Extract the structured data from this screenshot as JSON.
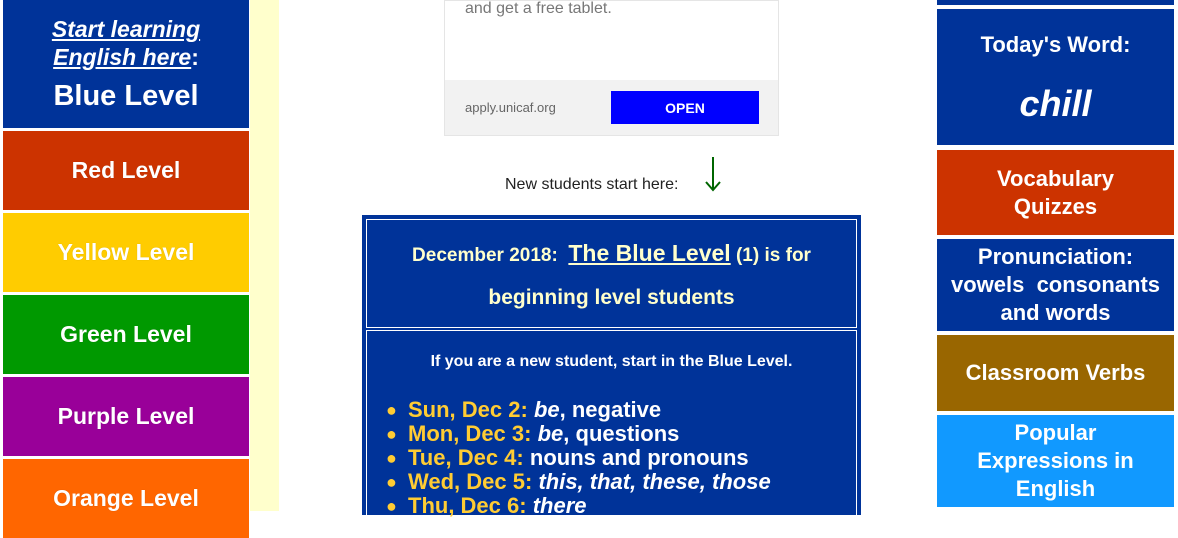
{
  "left_nav": {
    "learn_label_1": "Start learning",
    "learn_label_2": "English here",
    "learn_colon": ":",
    "current_level": "Blue Level",
    "levels": [
      {
        "label": "Red Level",
        "color": "#cc3300"
      },
      {
        "label": "Yellow Level",
        "color": "#ffcc00"
      },
      {
        "label": "Green Level",
        "color": "#009900"
      },
      {
        "label": "Purple Level",
        "color": "#990099"
      },
      {
        "label": "Orange Level",
        "color": "#ff6600"
      }
    ]
  },
  "ad": {
    "text": "and get a free tablet.",
    "url": "apply.unicaf.org",
    "button": "OPEN"
  },
  "new_students": "New students start here:",
  "main": {
    "date": "December 2018:",
    "level_link": "The Blue Level",
    "level_num": "(1)",
    "is_for": "is for",
    "audience": "beginning level students",
    "intro": "If you are a new student, start in the Blue Level.",
    "lessons": [
      {
        "day": "Sun, Dec 2:",
        "topic_italic": "be",
        "topic": ", negative"
      },
      {
        "day": "Mon, Dec 3:",
        "topic_italic": "be",
        "topic": ", questions"
      },
      {
        "day": "Tue, Dec 4:",
        "topic_italic": "",
        "topic": "nouns and pronouns"
      },
      {
        "day": "Wed, Dec 5:",
        "topic_italic": "this, that, these, those",
        "topic": ""
      },
      {
        "day": "Thu, Dec 6:",
        "topic_italic": "there",
        "topic": ""
      }
    ]
  },
  "right_nav": {
    "word_label": "Today's Word:",
    "word": "chill",
    "vocab": "Vocabulary Quizzes",
    "pron_1": "Pronunciation:",
    "pron_2": "vowels",
    "pron_3": "consonants",
    "pron_4": "and words",
    "verbs": "Classroom Verbs",
    "expressions": "Popular Expressions in English"
  },
  "colors": {
    "blue": "#003399",
    "red": "#cc3300",
    "brown": "#996600",
    "sky": "#1199ff"
  }
}
